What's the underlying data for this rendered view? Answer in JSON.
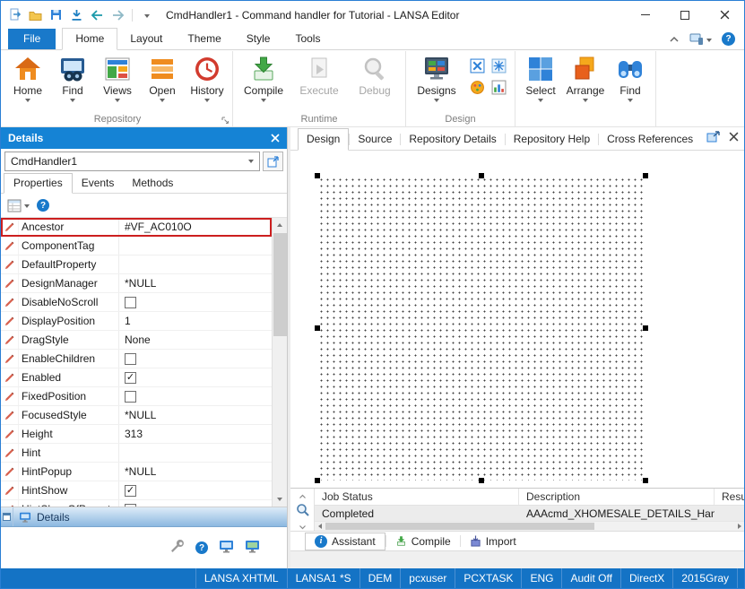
{
  "window": {
    "title": "CmdHandler1 - Command handler for Tutorial - LANSA Editor"
  },
  "ribbon": {
    "tabs": {
      "file": "File",
      "home": "Home",
      "layout": "Layout",
      "theme": "Theme",
      "style": "Style",
      "tools": "Tools"
    },
    "repository": {
      "label": "Repository",
      "home": "Home",
      "find": "Find",
      "views": "Views",
      "open": "Open",
      "history": "History"
    },
    "runtime": {
      "label": "Runtime",
      "compile": "Compile",
      "execute": "Execute",
      "debug": "Debug"
    },
    "design": {
      "label": "Design",
      "designs": "Designs"
    },
    "edit": {
      "select": "Select",
      "arrange": "Arrange",
      "find": "Find"
    }
  },
  "details": {
    "title": "Details",
    "component": "CmdHandler1",
    "tabs": {
      "properties": "Properties",
      "events": "Events",
      "methods": "Methods"
    },
    "properties": [
      {
        "name": "Ancestor",
        "value": "#VF_AC010O",
        "type": "text",
        "highlight": true
      },
      {
        "name": "ComponentTag",
        "value": "",
        "type": "text"
      },
      {
        "name": "DefaultProperty",
        "value": "",
        "type": "text"
      },
      {
        "name": "DesignManager",
        "value": "*NULL",
        "type": "text"
      },
      {
        "name": "DisableNoScroll",
        "value": false,
        "type": "checkbox"
      },
      {
        "name": "DisplayPosition",
        "value": "1",
        "type": "text"
      },
      {
        "name": "DragStyle",
        "value": "None",
        "type": "text"
      },
      {
        "name": "EnableChildren",
        "value": false,
        "type": "checkbox"
      },
      {
        "name": "Enabled",
        "value": true,
        "type": "checkbox"
      },
      {
        "name": "FixedPosition",
        "value": false,
        "type": "checkbox"
      },
      {
        "name": "FocusedStyle",
        "value": "*NULL",
        "type": "text"
      },
      {
        "name": "Height",
        "value": "313",
        "type": "text"
      },
      {
        "name": "Hint",
        "value": "",
        "type": "text"
      },
      {
        "name": "HintPopup",
        "value": "*NULL",
        "type": "text"
      },
      {
        "name": "HintShow",
        "value": true,
        "type": "checkbox"
      },
      {
        "name": "HintShowOfParent",
        "value": false,
        "type": "checkbox"
      }
    ],
    "collapsed_bar": "Details"
  },
  "main": {
    "tabs": [
      "Design",
      "Source",
      "Repository Details",
      "Repository Help",
      "Cross References"
    ],
    "selected_tab": "Design"
  },
  "jobs": {
    "columns": [
      "Job Status",
      "Description",
      "Result"
    ],
    "rows": [
      {
        "job_status": "Completed",
        "description": "AAAcmd_XHOMESALE_DETAILS_Handler - Co..."
      }
    ]
  },
  "bottom_tabs": {
    "assistant": "Assistant",
    "compile": "Compile",
    "import": "Import"
  },
  "statusbar": {
    "items": [
      "LANSA XHTML",
      "LANSA1 *S",
      "DEM",
      "pcxuser",
      "PCXTASK",
      "ENG",
      "Audit Off",
      "DirectX",
      "2015Gray"
    ]
  },
  "colors": {
    "accent_blue": "#1979ca",
    "panel_header_blue": "#1583d5",
    "statusbar_blue": "#1473c5",
    "highlight_red": "#cc1f1f"
  }
}
